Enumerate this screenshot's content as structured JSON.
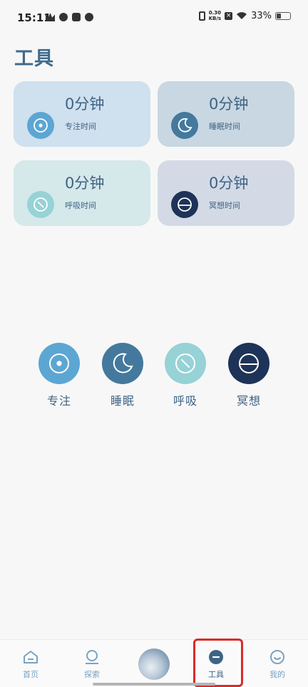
{
  "status_bar": {
    "time": "15:11",
    "netspeed_top": "0.30",
    "netspeed_bottom": "KB/s",
    "battery": "33%",
    "battery_level": 0.33
  },
  "page": {
    "title": "工具"
  },
  "stats": [
    {
      "value": "0分钟",
      "label": "专注时间",
      "icon": "target-icon",
      "color": "#5ca6d3"
    },
    {
      "value": "0分钟",
      "label": "睡眠时间",
      "icon": "moon-icon",
      "color": "#44799d"
    },
    {
      "value": "0分钟",
      "label": "呼吸时间",
      "icon": "breath-icon",
      "color": "#96d2d6"
    },
    {
      "value": "0分钟",
      "label": "冥想时间",
      "icon": "meditate-icon",
      "color": "#1e3358"
    }
  ],
  "tools": [
    {
      "label": "专注",
      "icon": "target-icon",
      "color": "#5ca6d3"
    },
    {
      "label": "睡眠",
      "icon": "moon-icon",
      "color": "#44799d"
    },
    {
      "label": "呼吸",
      "icon": "breath-icon",
      "color": "#96d2d6"
    },
    {
      "label": "冥想",
      "icon": "meditate-icon",
      "color": "#1e3358"
    }
  ],
  "nav": {
    "home": "首页",
    "explore": "探索",
    "tools": "工具",
    "mine": "我的",
    "active": "tools"
  }
}
